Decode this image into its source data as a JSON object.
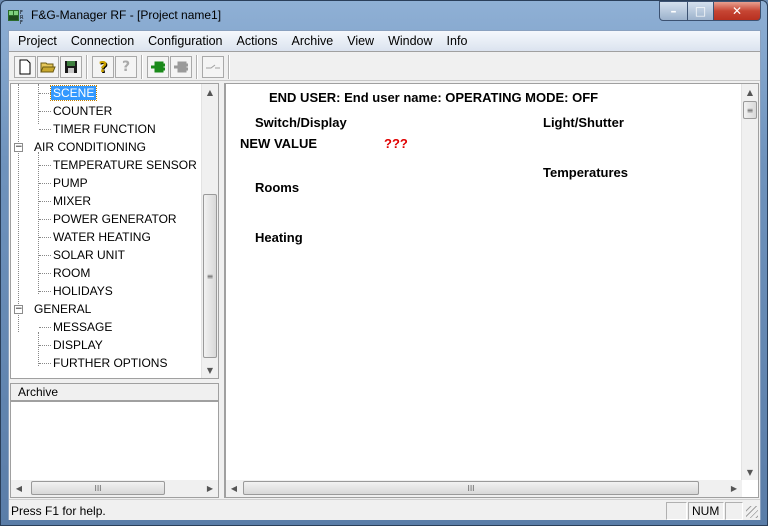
{
  "window": {
    "title": "F&G-Manager RF - [Project name1]",
    "icon": "fgrf-app-icon",
    "controls": {
      "minimize": "–",
      "maximize": "□",
      "close": "✕"
    }
  },
  "menu": [
    {
      "label": "Project"
    },
    {
      "label": "Connection"
    },
    {
      "label": "Configuration"
    },
    {
      "label": "Actions"
    },
    {
      "label": "Archive"
    },
    {
      "label": "View"
    },
    {
      "label": "Window"
    },
    {
      "label": "Info"
    }
  ],
  "toolbar": {
    "buttons": [
      {
        "icon": "new-document-icon",
        "glyph": "🗋"
      },
      {
        "icon": "open-folder-icon",
        "glyph": "📂"
      },
      {
        "icon": "save-icon",
        "glyph": "💾"
      },
      {
        "icon": "help-icon",
        "glyph": "?"
      },
      {
        "icon": "context-help-icon",
        "glyph": "?"
      },
      {
        "icon": "connect-icon",
        "glyph": "⇐"
      },
      {
        "icon": "disconnect-icon",
        "glyph": "⇐"
      },
      {
        "icon": "switch-icon",
        "glyph": "⌐"
      }
    ]
  },
  "tree": {
    "items": [
      {
        "label": "SCENE",
        "level": 2,
        "selected": true
      },
      {
        "label": "COUNTER",
        "level": 2
      },
      {
        "label": "TIMER FUNCTION",
        "level": 2
      },
      {
        "label": "AIR CONDITIONING",
        "level": 1,
        "expander": "−"
      },
      {
        "label": "TEMPERATURE SENSOR",
        "level": 2
      },
      {
        "label": "PUMP",
        "level": 2
      },
      {
        "label": "MIXER",
        "level": 2
      },
      {
        "label": "POWER GENERATOR",
        "level": 2
      },
      {
        "label": "WATER HEATING",
        "level": 2
      },
      {
        "label": "SOLAR UNIT",
        "level": 2
      },
      {
        "label": "ROOM",
        "level": 2
      },
      {
        "label": "HOLIDAYS",
        "level": 2
      },
      {
        "label": "GENERAL",
        "level": 1,
        "expander": "−"
      },
      {
        "label": "MESSAGE",
        "level": 2
      },
      {
        "label": "DISPLAY",
        "level": 2
      },
      {
        "label": "FURTHER OPTIONS",
        "level": 2
      }
    ]
  },
  "archive": {
    "header": "Archive"
  },
  "main": {
    "header": "END USER: End user name: OPERATING MODE: OFF",
    "switch_display": "Switch/Display",
    "new_value_label": "NEW VALUE",
    "new_value": "???",
    "new_value_color": "#e00000",
    "light_shutter": "Light/Shutter",
    "temperatures": "Temperatures",
    "rooms": "Rooms",
    "heating": "Heating"
  },
  "scroll": {
    "thumb_grip": "≡",
    "hgrip": "III",
    "up": "▲",
    "down": "▼",
    "left": "◀",
    "right": "▶"
  },
  "status": {
    "text": "Press F1 for help.",
    "num": "NUM"
  }
}
